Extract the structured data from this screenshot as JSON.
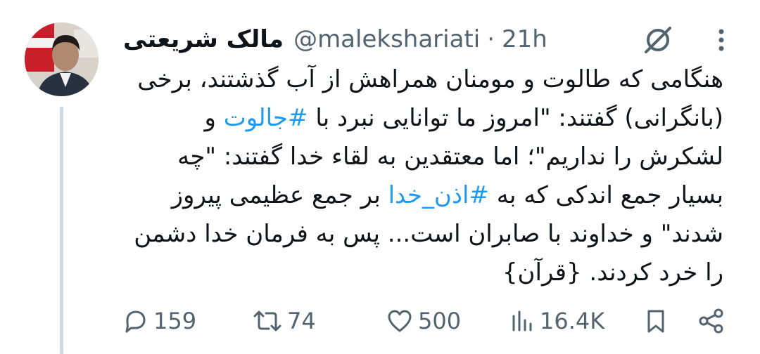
{
  "tweet": {
    "display_name": "مالک شریعتی",
    "handle": "@malekshariati",
    "separator": "·",
    "time": "21h",
    "text_part1": "هنگامی که طالوت و مومنان همراهش از آب گذشتند، برخی (بانگرانی) گفتند: \"امروز ما توانایی نبرد با ",
    "hashtag1": "#جالوت",
    "text_part2": " و لشکرش را نداریم\"؛ اما معتقدین به لقاء خدا گفتند: \"چه بسیار جمع اندکی که به ",
    "hashtag2": "#اذن_خدا",
    "text_part3": " بر جمع عظیمی پیروز شدند\" و خداوند با صابران است... پس به فرمان خدا دشمن را خرد کردند. {قرآن}"
  },
  "actions": {
    "replies": "159",
    "retweets": "74",
    "likes": "500",
    "views": "16.4K"
  },
  "colors": {
    "text": "#0f1419",
    "secondary": "#536471",
    "hashtag": "#1d9bf0",
    "thread_line": "#cfd9de"
  },
  "icons": [
    "grok-icon",
    "more-icon",
    "reply-icon",
    "retweet-icon",
    "like-icon",
    "views-icon",
    "bookmark-icon",
    "share-icon"
  ]
}
